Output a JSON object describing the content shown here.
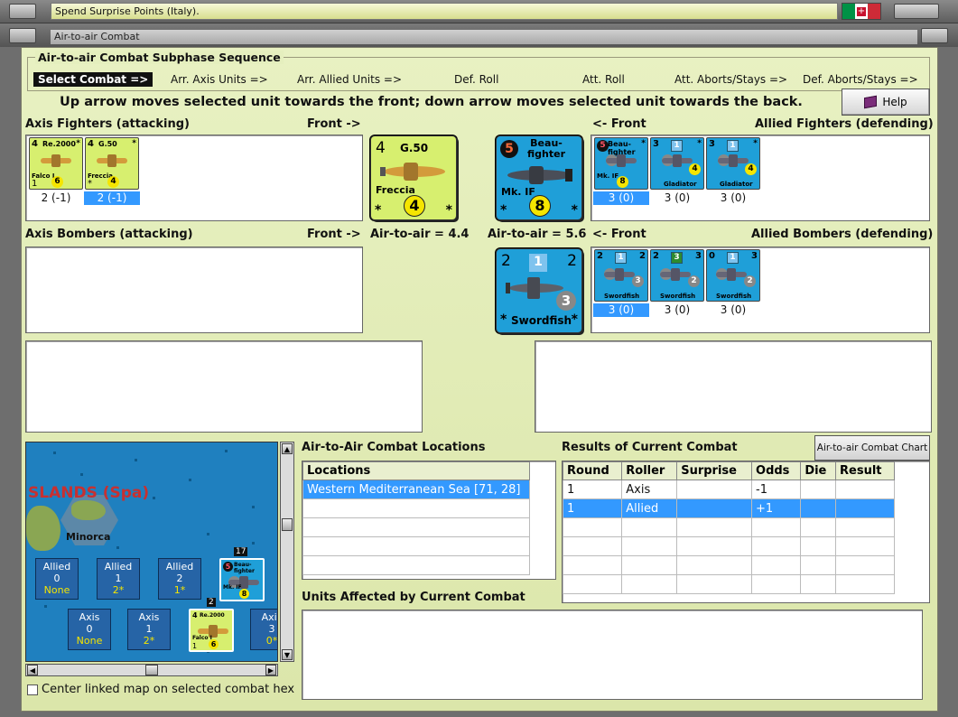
{
  "window": {
    "title": "Spend Surprise Points (Italy).",
    "subtitle": "Air-to-air Combat"
  },
  "phase": {
    "group_title": "Air-to-air Combat Subphase Sequence",
    "steps": [
      "Select Combat =>",
      "Arr. Axis Units =>",
      "Arr. Allied Units =>",
      "Def. Roll",
      "Att. Roll",
      "Att. Aborts/Stays =>",
      "Def. Aborts/Stays =>"
    ],
    "active_step": 0
  },
  "instruction": "Up arrow moves selected unit towards the front; down arrow moves selected unit towards the back.",
  "help_label": "Help",
  "labels": {
    "axis_fighters": "Axis Fighters (attacking)",
    "front_right": "Front ->",
    "front_left": "<- Front",
    "allied_fighters": "Allied Fighters (defending)",
    "axis_bombers": "Axis Bombers (attacking)",
    "allied_bombers": "Allied Bombers (defending)",
    "axis_a2a": "Air-to-air = 4.4",
    "allied_a2a": "Air-to-air = 5.6"
  },
  "axis_fighters": [
    {
      "type": "Re.2000",
      "name": "Falco I",
      "top_left": "4",
      "bottom_left": "1",
      "rating": "6",
      "caption": "2 (-1)",
      "selected": false
    },
    {
      "type": "G.50",
      "name": "Freccia",
      "top_left": "4",
      "bottom_left": "*",
      "rating": "4",
      "caption": "2 (-1)",
      "selected": true
    }
  ],
  "allied_fighters": [
    {
      "type": "Beau-fighter",
      "name": "Mk. IF",
      "top_left": "5",
      "rating": "8",
      "caption": "3 (0)",
      "selected": true
    },
    {
      "type": "",
      "name": "Gladiator",
      "top_left": "3",
      "box": "1",
      "rating": "4",
      "caption": "3 (0)",
      "selected": false
    },
    {
      "type": "",
      "name": "Gladiator",
      "top_left": "3",
      "box": "1",
      "rating": "4",
      "caption": "3 (0)",
      "selected": false
    }
  ],
  "allied_bombers": [
    {
      "name": "Swordfish",
      "top_left": "2",
      "box": "1",
      "top_right": "2",
      "grey": "3",
      "caption": "3 (0)",
      "selected": true,
      "green": false
    },
    {
      "name": "Swordfish",
      "top_left": "2",
      "box": "3",
      "top_right": "3",
      "grey": "2",
      "caption": "3 (0)",
      "selected": false,
      "green": true
    },
    {
      "name": "Swordfish",
      "top_left": "0",
      "box": "1",
      "top_right": "3",
      "grey": "2",
      "caption": "3 (0)",
      "selected": false,
      "green": false
    }
  ],
  "big_axis": {
    "top_left": "4",
    "type": "G.50",
    "name": "Freccia",
    "rating": "4"
  },
  "big_allied_fighter": {
    "top_left": "5",
    "type": "Beau-fighter",
    "type_line1": "Beau-",
    "type_line2": "fighter",
    "name": "Mk. IF",
    "rating": "8"
  },
  "big_allied_bomber": {
    "top_left": "2",
    "box": "1",
    "top_right": "2",
    "grey": "3",
    "name": "Swordfish"
  },
  "map": {
    "region": "SLANDS (Spa)",
    "hex_name": "Minorca",
    "stack_top": "17",
    "stack_bottom": "2",
    "allied_boxes": [
      {
        "side": "Allied",
        "num": "0",
        "val": "None"
      },
      {
        "side": "Allied",
        "num": "1",
        "val": "2*"
      },
      {
        "side": "Allied",
        "num": "2",
        "val": "1*"
      }
    ],
    "axis_boxes": [
      {
        "side": "Axis",
        "num": "0",
        "val": "None"
      },
      {
        "side": "Axis",
        "num": "1",
        "val": "2*"
      },
      {
        "side": "Axis",
        "num": "3",
        "val": "0*"
      }
    ],
    "mini_allied": {
      "top_left": "5",
      "type": "Beau-fighter",
      "name": "Mk. IF",
      "rating": "8"
    },
    "mini_axis": {
      "top_left": "4",
      "type": "Re.2000",
      "name": "Falco I",
      "bottom_left": "1",
      "rating": "6"
    }
  },
  "center_checkbox": "Center linked map on selected combat hex",
  "locations": {
    "title": "Air-to-Air Combat Locations",
    "header": "Locations",
    "rows": [
      "Western Mediterranean Sea [71, 28]"
    ]
  },
  "results": {
    "title": "Results of Current Combat",
    "chart_button": "Air-to-air Combat Chart",
    "columns": [
      "Round",
      "Roller",
      "Surprise",
      "Odds",
      "Die",
      "Result"
    ],
    "rows": [
      [
        "1",
        "Axis",
        "",
        "-1",
        "",
        ""
      ],
      [
        "1",
        "Allied",
        "",
        "+1",
        "",
        ""
      ]
    ]
  },
  "units_affected_title": "Units Affected by Current Combat"
}
